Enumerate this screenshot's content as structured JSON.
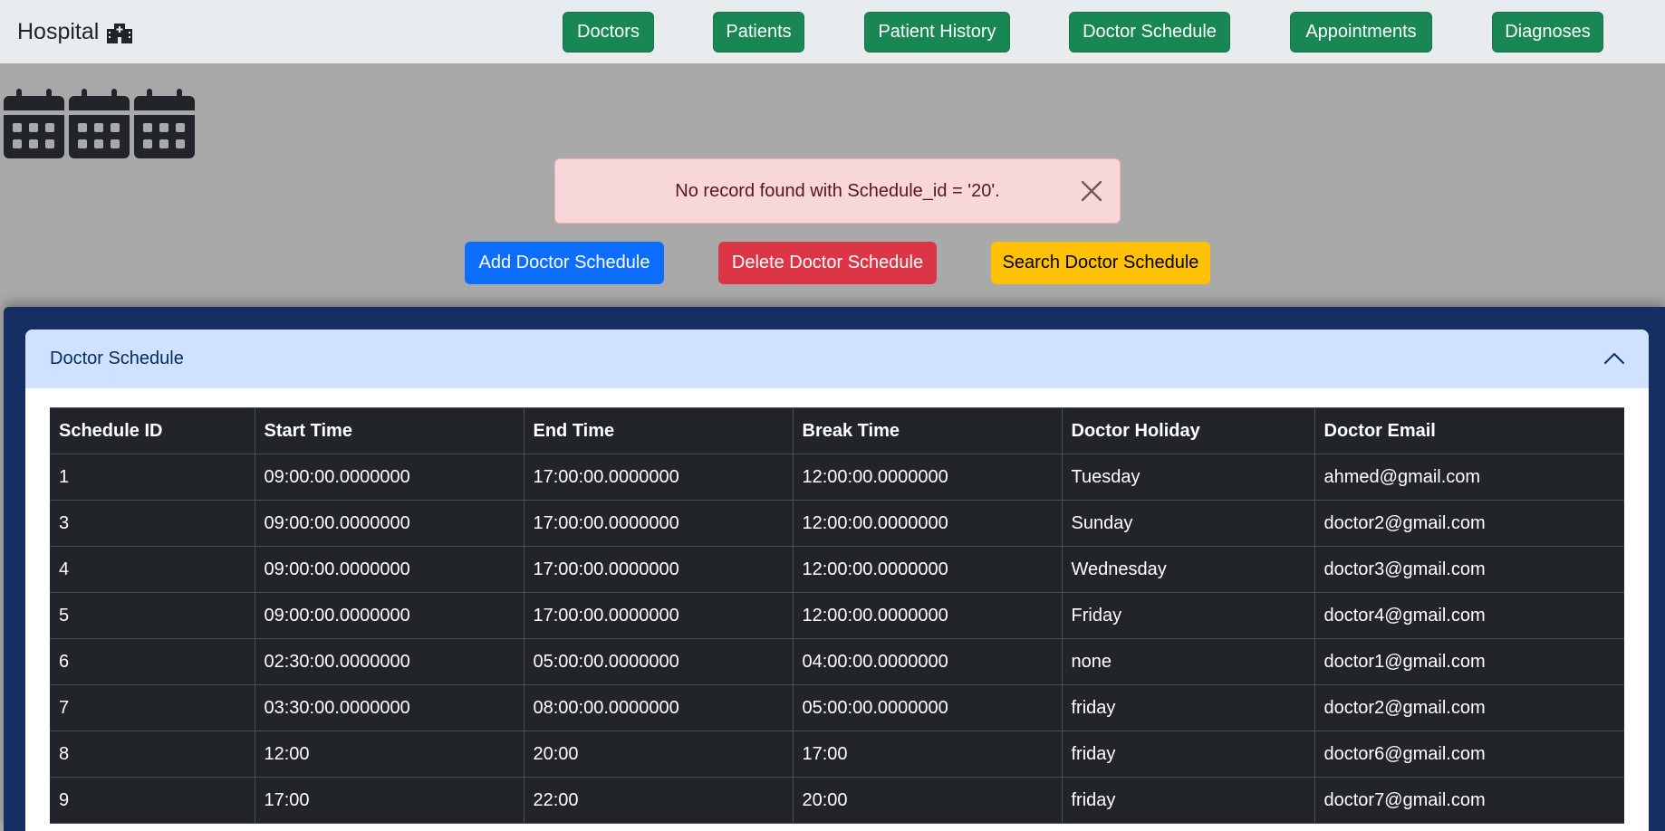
{
  "navbar": {
    "brand": "Hospital",
    "items": [
      {
        "label": "Doctors"
      },
      {
        "label": "Patients"
      },
      {
        "label": "Patient History"
      },
      {
        "label": "Doctor Schedule"
      },
      {
        "label": "Appointments"
      },
      {
        "label": "Diagnoses"
      }
    ]
  },
  "alert": {
    "message": "No record found with Schedule_id = '20'."
  },
  "actions": {
    "add": "Add Doctor Schedule",
    "delete": "Delete Doctor Schedule",
    "search": "Search Doctor Schedule"
  },
  "accordion": {
    "title": "Doctor Schedule"
  },
  "table": {
    "columns": [
      "Schedule ID",
      "Start Time",
      "End Time",
      "Break Time",
      "Doctor Holiday",
      "Doctor Email"
    ],
    "rows": [
      [
        "1",
        "09:00:00.0000000",
        "17:00:00.0000000",
        "12:00:00.0000000",
        "Tuesday",
        "ahmed@gmail.com"
      ],
      [
        "3",
        "09:00:00.0000000",
        "17:00:00.0000000",
        "12:00:00.0000000",
        "Sunday",
        "doctor2@gmail.com"
      ],
      [
        "4",
        "09:00:00.0000000",
        "17:00:00.0000000",
        "12:00:00.0000000",
        "Wednesday",
        "doctor3@gmail.com"
      ],
      [
        "5",
        "09:00:00.0000000",
        "17:00:00.0000000",
        "12:00:00.0000000",
        "Friday",
        "doctor4@gmail.com"
      ],
      [
        "6",
        "02:30:00.0000000",
        "05:00:00.0000000",
        "04:00:00.0000000",
        "none",
        "doctor1@gmail.com"
      ],
      [
        "7",
        "03:30:00.0000000",
        "08:00:00.0000000",
        "05:00:00.0000000",
        "friday",
        "doctor2@gmail.com"
      ],
      [
        "8",
        "12:00",
        "20:00",
        "17:00",
        "friday",
        "doctor6@gmail.com"
      ],
      [
        "9",
        "17:00",
        "22:00",
        "20:00",
        "friday",
        "doctor7@gmail.com"
      ]
    ]
  },
  "colors": {
    "nav_button": "#198754",
    "primary": "#0d6efd",
    "danger": "#dc3545",
    "warning": "#ffc107",
    "panel": "#152f63",
    "table_bg": "#212529"
  },
  "icons": {
    "brand": "hospital-icon",
    "calendars": [
      "calendar-icon",
      "calendar-icon",
      "calendar-icon"
    ],
    "alert_close": "close-icon",
    "accordion_toggle": "chevron-up-icon"
  }
}
